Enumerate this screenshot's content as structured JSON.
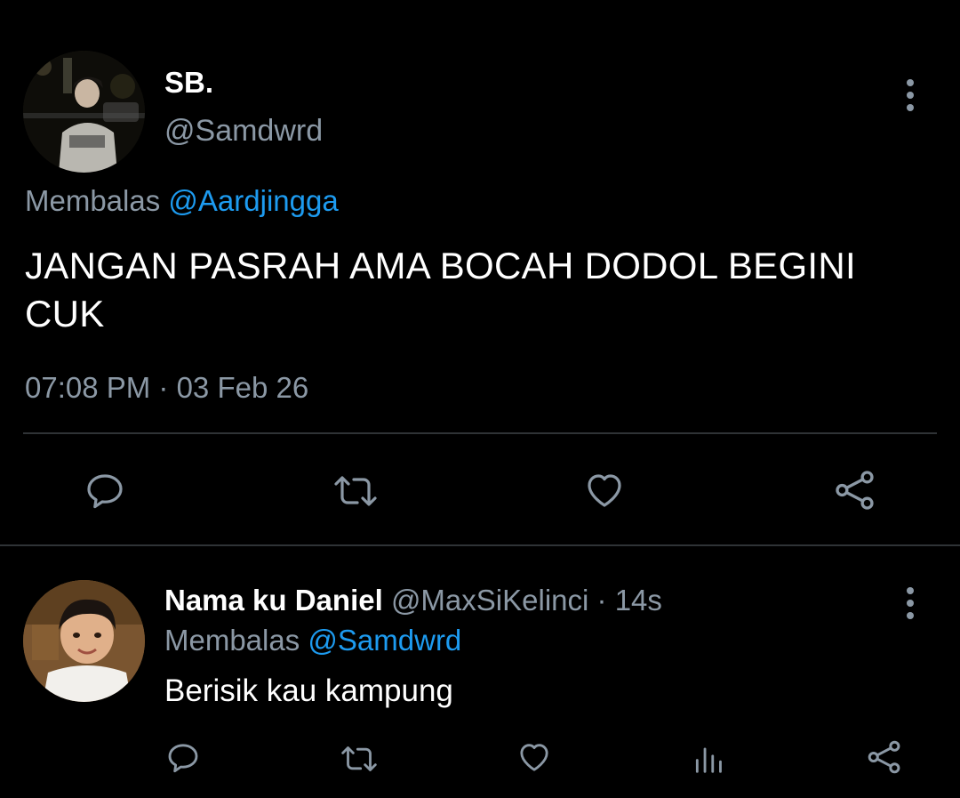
{
  "main_tweet": {
    "display_name": "SB.",
    "handle": "@Samdwrd",
    "replying_to_prefix": "Membalas",
    "replying_to_handle": "@Aardjingga",
    "text": "JANGAN PASRAH AMA BOCAH DODOL BEGINI CUK",
    "timestamp": "07:08 PM · 03 Feb 26",
    "actions": [
      "reply-icon",
      "retweet-icon",
      "like-icon",
      "share-icon"
    ]
  },
  "reply_tweet": {
    "display_name": "Nama ku Daniel",
    "handle": "@MaxSiKelinci",
    "separator": "·",
    "time": "14s",
    "replying_to_prefix": "Membalas",
    "replying_to_handle": "@Samdwrd",
    "text": "Berisik kau kampung",
    "actions": [
      "reply-icon",
      "retweet-icon",
      "like-icon",
      "analytics-icon",
      "share-icon"
    ]
  },
  "colors": {
    "background": "#000000",
    "text_primary": "#ffffff",
    "text_secondary": "#8b98a5",
    "accent": "#1d9bf0",
    "divider": "#2f3336"
  }
}
